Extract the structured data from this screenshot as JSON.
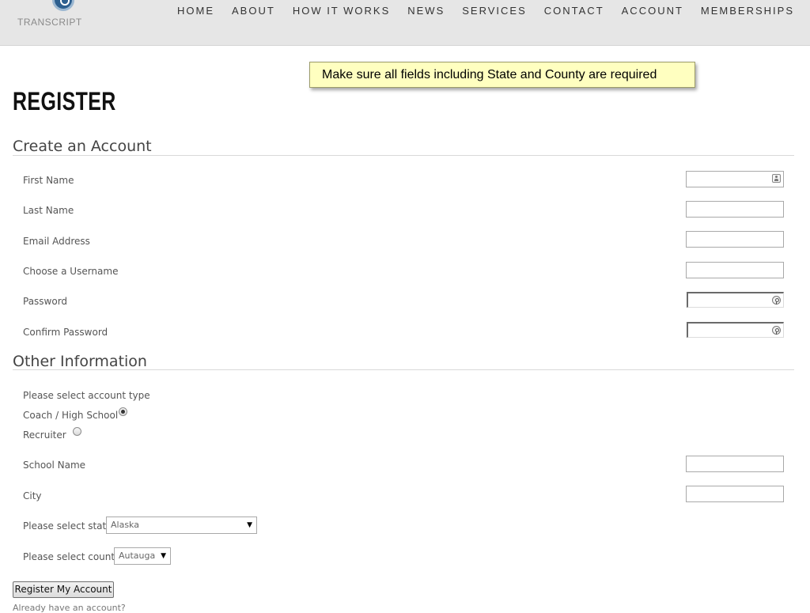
{
  "header": {
    "logo_text": "TRANSCRIPT",
    "nav": [
      "HOME",
      "ABOUT",
      "HOW IT WORKS",
      "NEWS",
      "SERVICES",
      "CONTACT",
      "ACCOUNT",
      "MEMBERSHIPS"
    ]
  },
  "notice": {
    "text": "Make sure all fields including State and County are required",
    "background": "#ffffc0"
  },
  "page_title": "REGISTER",
  "create_account": {
    "title": "Create an Account",
    "fields": {
      "first_name": {
        "label": "First Name",
        "value": ""
      },
      "last_name": {
        "label": "Last Name",
        "value": ""
      },
      "email": {
        "label": "Email Address",
        "value": ""
      },
      "username": {
        "label": "Choose a Username",
        "value": ""
      },
      "password": {
        "label": "Password",
        "value": ""
      },
      "confirm_password": {
        "label": "Confirm Password",
        "value": ""
      }
    }
  },
  "other_info": {
    "title": "Other Information",
    "account_type_prompt": "Please select account type",
    "account_types": [
      {
        "label": "Coach / High School",
        "selected": true
      },
      {
        "label": "Recruiter",
        "selected": false
      }
    ],
    "school_name": {
      "label": "School Name",
      "value": ""
    },
    "city": {
      "label": "City",
      "value": ""
    },
    "state": {
      "label": "Please select state",
      "selected": "Alaska"
    },
    "county": {
      "label": "Please select county",
      "selected": "Autauga"
    }
  },
  "register_button": "Register My Account",
  "footnote": "Already have an account?"
}
